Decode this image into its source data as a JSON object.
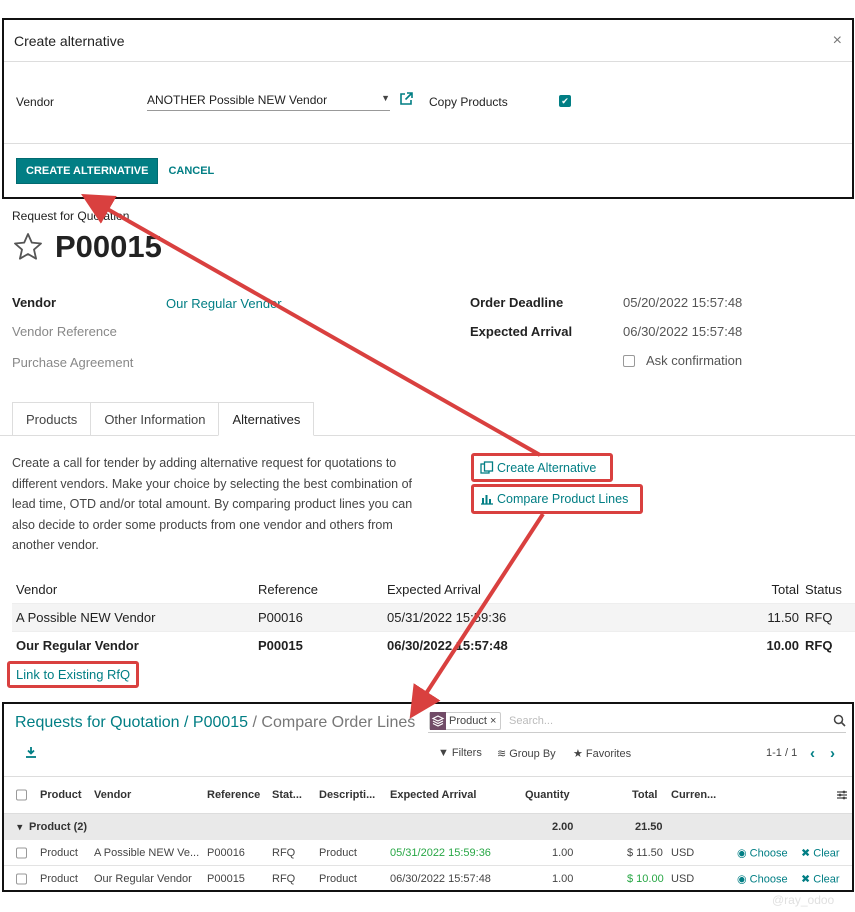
{
  "dialog": {
    "title": "Create alternative",
    "close": "×",
    "vendor_label": "Vendor",
    "vendor_value": "ANOTHER Possible NEW Vendor",
    "copy_products_label": "Copy Products",
    "copy_products_checked": true,
    "create_button": "CREATE ALTERNATIVE",
    "cancel_button": "CANCEL"
  },
  "form": {
    "doc_type": "Request for Quotation",
    "name": "P00015",
    "vendor_label": "Vendor",
    "vendor_value": "Our Regular Vendor",
    "vendor_ref_label": "Vendor Reference",
    "purchase_agreement_label": "Purchase Agreement",
    "order_deadline_label": "Order Deadline",
    "order_deadline_value": "05/20/2022 15:57:48",
    "expected_arrival_label": "Expected Arrival",
    "expected_arrival_value": "06/30/2022 15:57:48",
    "ask_confirmation_label": "Ask confirmation",
    "tabs": [
      "Products",
      "Other Information",
      "Alternatives"
    ],
    "active_tab": "Alternatives",
    "alternatives_description": "Create a call for tender by adding alternative request for quotations to different vendors. Make your choice by selecting the best combination of lead time, OTD and/or total amount. By comparing product lines you can also decide to order some products from one vendor and others from another vendor.",
    "create_alternative_link": "Create Alternative",
    "compare_product_lines_link": "Compare Product Lines",
    "alt_table": {
      "headers": [
        "Vendor",
        "Reference",
        "Expected Arrival",
        "Total",
        "Status"
      ],
      "rows": [
        [
          "A Possible NEW Vendor",
          "P00016",
          "05/31/2022 15:59:36",
          "11.50",
          "RFQ"
        ],
        [
          "Our Regular Vendor",
          "P00015",
          "06/30/2022 15:57:48",
          "10.00",
          "RFQ"
        ]
      ]
    },
    "link_existing": "Link to Existing RfQ"
  },
  "compare": {
    "breadcrumb_root": "Requests for Quotation",
    "breadcrumb_sep": " / ",
    "breadcrumb_mid": "P00015",
    "breadcrumb_current": "Compare Order Lines",
    "facet": "Product",
    "facet_close": "×",
    "search_placeholder": "Search...",
    "filters": "Filters",
    "group_by": "Group By",
    "favorites": "Favorites",
    "pager": "1-1 / 1",
    "columns": [
      "Product",
      "Vendor",
      "Reference",
      "Stat...",
      "Descripti...",
      "Expected Arrival",
      "Quantity",
      "Total",
      "Curren..."
    ],
    "group": {
      "label": "Product (2)",
      "quantity": "2.00",
      "total": "21.50"
    },
    "rows": [
      {
        "product": "Product",
        "vendor": "A Possible NEW Ve...",
        "reference": "P00016",
        "status": "RFQ",
        "description": "Product",
        "expected": "05/31/2022 15:59:36",
        "quantity": "1.00",
        "total": "$ 11.50",
        "currency": "USD",
        "choose": "Choose",
        "clear": "Clear"
      },
      {
        "product": "Product",
        "vendor": "Our Regular Vendor",
        "reference": "P00015",
        "status": "RFQ",
        "description": "Product",
        "expected": "06/30/2022 15:57:48",
        "quantity": "1.00",
        "total": "$ 10.00",
        "currency": "USD",
        "choose": "Choose",
        "clear": "Clear"
      }
    ]
  },
  "watermark": "@ray_odoo",
  "colors": {
    "accent": "#017e84",
    "highlight": "#d9403f",
    "positive": "#28a745",
    "brand": "#714b67"
  }
}
